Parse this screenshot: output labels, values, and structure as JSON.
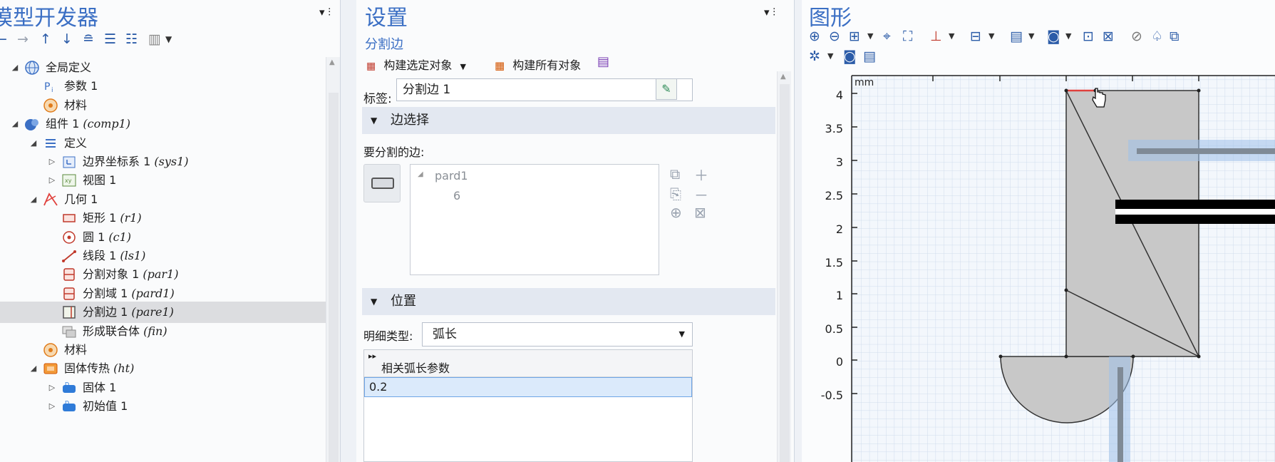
{
  "left": {
    "title": "模型开发器",
    "pin": "▾ ᵽ",
    "toolbar": [
      "←",
      "→",
      "↑",
      "↓",
      "⩮",
      "⊤≡",
      "⊥≡",
      "▥",
      "▾"
    ],
    "tree": [
      {
        "label": "全局定义",
        "tag": "",
        "expanded": true
      },
      {
        "label": "参数 1",
        "tag": ""
      },
      {
        "label": "材料",
        "tag": ""
      },
      {
        "label": "组件 1 ",
        "tag": "(comp1)",
        "expanded": true
      },
      {
        "label": "定义",
        "tag": "",
        "expanded": true
      },
      {
        "label": "边界坐标系 1 ",
        "tag": "(sys1)"
      },
      {
        "label": "视图 1",
        "tag": ""
      },
      {
        "label": "几何 1",
        "tag": "",
        "expanded": true
      },
      {
        "label": "矩形 1 ",
        "tag": "(r1)"
      },
      {
        "label": "圆 1 ",
        "tag": "(c1)"
      },
      {
        "label": "线段 1 ",
        "tag": "(ls1)"
      },
      {
        "label": "分割对象 1 ",
        "tag": "(par1)"
      },
      {
        "label": "分割域 1 ",
        "tag": "(pard1)"
      },
      {
        "label": "分割边 1 ",
        "tag": "(pare1)"
      },
      {
        "label": "形成联合体 ",
        "tag": "(fin)"
      },
      {
        "label": "材料",
        "tag": ""
      },
      {
        "label": "固体传热 ",
        "tag": "(ht)",
        "expanded": true
      },
      {
        "label": "固体 1",
        "tag": ""
      },
      {
        "label": "初始值 1",
        "tag": ""
      }
    ]
  },
  "mid": {
    "title": "设置",
    "subtitle": "分割边",
    "build_selected": "构建选定对象",
    "build_all": "构建所有对象",
    "label_caption": "标签:",
    "label_value": "分割边 1",
    "section_edges": "边选择",
    "edges_caption": "要分割的边:",
    "list_parent": "pard1",
    "list_child": "6",
    "section_position": "位置",
    "spec_caption": "明细类型:",
    "spec_value": "弧长",
    "param_header": "相关弧长参数",
    "param_value": "0.2"
  },
  "right": {
    "title": "图形",
    "unit": "mm",
    "y_ticks": [
      "4",
      "3.5",
      "3",
      "2.5",
      "2",
      "1.5",
      "1",
      "0.5",
      "0",
      "-0.5"
    ]
  },
  "colors": {
    "accent": "#3b6fc4",
    "selection": "#dcdde0",
    "geometry_fill": "#c7c7c7",
    "highlight_edge": "#e0413d"
  }
}
